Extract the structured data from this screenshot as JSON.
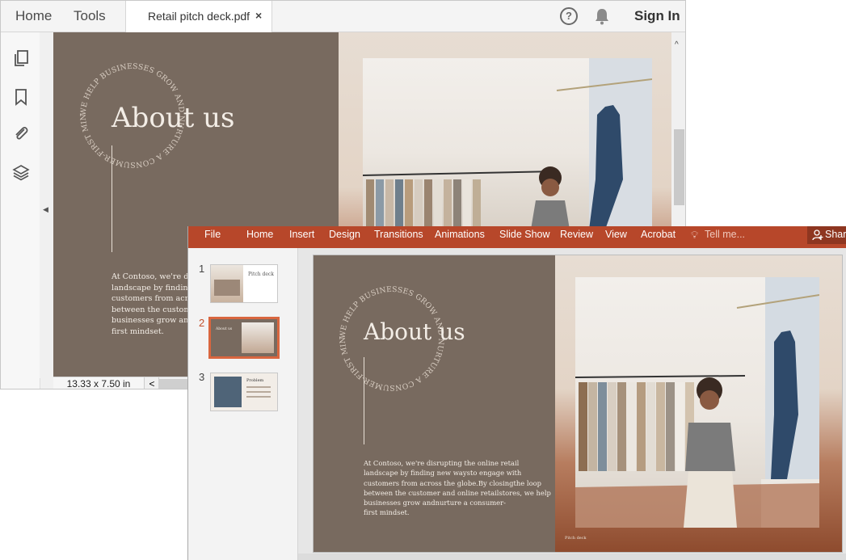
{
  "acrobat": {
    "tabs": {
      "home": "Home",
      "tools": "Tools"
    },
    "document_tab": {
      "title": "Retail pitch deck.pdf",
      "close": "×"
    },
    "help_glyph": "?",
    "sign_in": "Sign In",
    "left_tools": [
      "pages-icon",
      "bookmark-icon",
      "attachment-icon",
      "layers-icon"
    ],
    "page_size": "13.33 x 7.50 in",
    "scroll_left": "<",
    "scroll_up": "^",
    "collapse_glyph": "◀"
  },
  "slide": {
    "title": "About us",
    "circle_text": "WE HELP BUSINESSES GROW AND NURTURE A CONSUMER-FIRST MINDSET.",
    "body_lines": [
      "At Contoso, we're disrupting the online retail",
      "landscape by finding new waysto engage with",
      "customers from across the globe.By closingthe loop",
      "between the customer and online retailstores, we help",
      "businesses grow andnurture a consumer-",
      "first mindset."
    ],
    "acro_body_lines": [
      "At Contoso, we're disru",
      "landscape by finding",
      "customers from acros",
      "between the custome",
      "businesses grow and",
      "first mindset."
    ],
    "footer": "Pitch deck"
  },
  "powerpoint": {
    "tabs": [
      "File",
      "Home",
      "Insert",
      "Design",
      "Transitions",
      "Animations",
      "Slide Show",
      "Review",
      "View",
      "Acrobat"
    ],
    "tell_me": "Tell me...",
    "share": "Shar",
    "thumbnails": [
      {
        "number": "1",
        "label": "Pitch deck"
      },
      {
        "number": "2",
        "label": "About us"
      },
      {
        "number": "3",
        "label": "Problem"
      }
    ],
    "accent": "#b7472a"
  }
}
